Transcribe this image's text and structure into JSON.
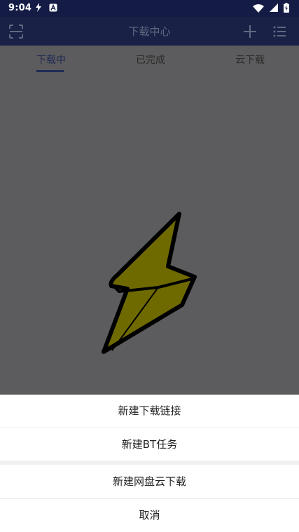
{
  "status_bar": {
    "time": "9:04",
    "left_icons": [
      "flash-icon",
      "app-a-icon"
    ],
    "right_icons": [
      "wifi-icon",
      "signal-icon",
      "battery-icon"
    ]
  },
  "header": {
    "title": "下载中心",
    "left_icon": "scan-icon",
    "right_icons": [
      "add-icon",
      "list-menu-icon"
    ]
  },
  "tabs": [
    {
      "label": "下载中",
      "active": true
    },
    {
      "label": "已完成",
      "active": false
    },
    {
      "label": "云下载",
      "active": false
    }
  ],
  "content": {
    "empty_state_icon": "lightning-bolt-icon"
  },
  "bottom_sheet": {
    "items": [
      {
        "label": "新建下载链接"
      },
      {
        "label": "新建BT任务"
      },
      {
        "label": "新建网盘云下载"
      },
      {
        "label": "取消"
      }
    ]
  },
  "colors": {
    "status_bar_bg": "#141c45",
    "header_bg": "#1a2146",
    "overlay_gray": "#5c5c5e",
    "active_tab": "#1f2a55",
    "bolt_fill": "#6f6a00"
  }
}
